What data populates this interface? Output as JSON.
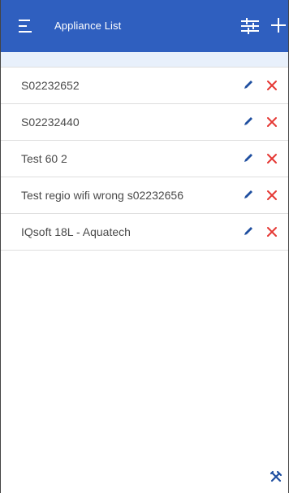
{
  "header": {
    "title": "Appliance List",
    "background_color": "#2f5fbf",
    "menu_icon": "menu-icon",
    "filter_icon": "sliders-icon",
    "add_icon": "plus-icon"
  },
  "subheader": {
    "background_color": "#e8f0fb"
  },
  "appliances": [
    {
      "name": "S02232652"
    },
    {
      "name": "S02232440"
    },
    {
      "name": "Test 60 2"
    },
    {
      "name": "Test regio wifi wrong s02232656"
    },
    {
      "name": "IQsoft 18L - Aquatech"
    }
  ],
  "row_actions": {
    "edit_icon": "pencil-icon",
    "edit_color": "#1f4fa0",
    "delete_icon": "close-icon",
    "delete_color": "#e53935"
  },
  "footer": {
    "tools_icon": "tools-icon",
    "tools_color": "#1f4fa0"
  }
}
